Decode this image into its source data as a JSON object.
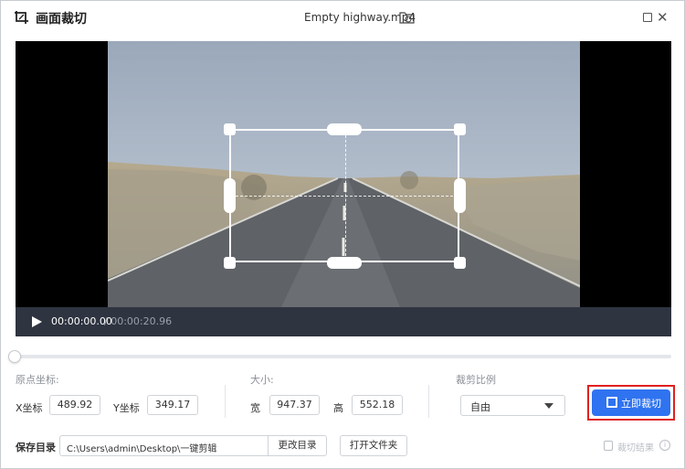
{
  "app": {
    "title": "画面裁切",
    "file_name": "Empty highway.mp4"
  },
  "icons": {
    "app": "crop-app-icon",
    "file": "folder-refresh-icon",
    "maximize": "maximize-icon",
    "close": "close-icon",
    "play": "play-icon",
    "crop_now": "crop-icon",
    "result_check": "checkbox-icon",
    "result_info": "info-icon"
  },
  "player": {
    "current_time": "00:00:00.00",
    "total_time": "/ 00:00:20.96",
    "progress": 0.0
  },
  "origin": {
    "section_label": "原点坐标:",
    "x_label": "X坐标",
    "x_value": "489.92",
    "y_label": "Y坐标",
    "y_value": "349.17"
  },
  "size": {
    "section_label": "大小:",
    "width_label": "宽",
    "width_value": "947.37",
    "height_label": "高",
    "height_value": "552.18"
  },
  "ratio": {
    "section_label": "裁剪比例",
    "selected": "自由"
  },
  "actions": {
    "crop_now_label": "立即裁切",
    "change_dir_label": "更改目录",
    "open_folder_label": "打开文件夹"
  },
  "save": {
    "label": "保存目录",
    "path": "C:\\Users\\admin\\Desktop\\一键剪辑"
  },
  "result": {
    "label": "裁切结果",
    "info": "i"
  },
  "colors": {
    "accent": "#2f73f0",
    "highlight_outline": "#e02020",
    "playbar": "#2e3440"
  }
}
